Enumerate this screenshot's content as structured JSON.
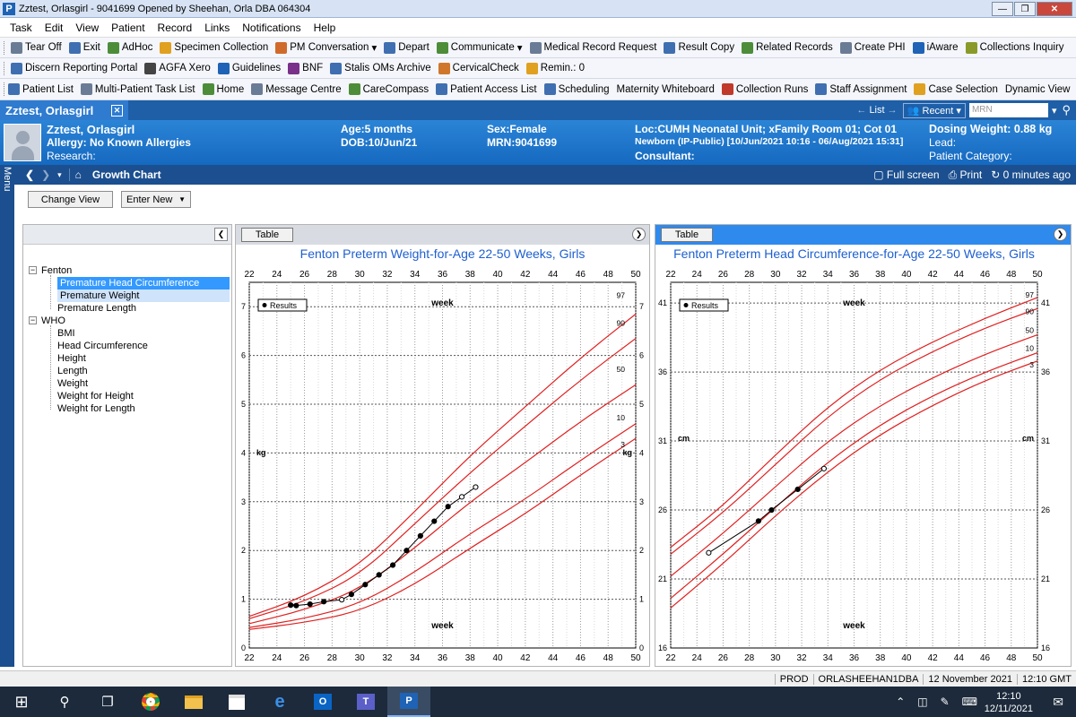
{
  "window": {
    "title": "Zztest, Orlasgirl - 9041699 Opened by Sheehan, Orla   DBA 064304"
  },
  "menu": [
    "Task",
    "Edit",
    "View",
    "Patient",
    "Record",
    "Links",
    "Notifications",
    "Help"
  ],
  "toolbar1": [
    {
      "label": "Tear Off",
      "icon": "tear-off-icon",
      "color": "#6a7b95"
    },
    {
      "label": "Exit",
      "icon": "exit-icon",
      "color": "#3f6fb0"
    },
    {
      "label": "AdHoc",
      "icon": "adhoc-icon",
      "color": "#4d8d3a"
    },
    {
      "label": "Specimen Collection",
      "icon": "specimen-icon",
      "color": "#e0a020"
    },
    {
      "label": "PM Conversation",
      "icon": "pm-conversation-icon",
      "color": "#d06a2a",
      "dropdown": true
    },
    {
      "label": "Depart",
      "icon": "depart-icon",
      "color": "#3f6fb0"
    },
    {
      "label": "Communicate",
      "icon": "communicate-icon",
      "color": "#4d8d3a",
      "dropdown": true
    },
    {
      "label": "Medical Record Request",
      "icon": "medical-record-icon",
      "color": "#6a7b95"
    },
    {
      "label": "Result Copy",
      "icon": "result-copy-icon",
      "color": "#3f6fb0"
    },
    {
      "label": "Related Records",
      "icon": "related-records-icon",
      "color": "#4d8d3a"
    },
    {
      "label": "Create PHI",
      "icon": "create-phi-icon",
      "color": "#6a7b95"
    },
    {
      "label": "iAware",
      "icon": "iaware-icon",
      "color": "#1e63b5"
    },
    {
      "label": "Collections Inquiry",
      "icon": "collections-icon",
      "color": "#8a9a2a"
    }
  ],
  "toolbar2": [
    {
      "label": "Discern Reporting Portal",
      "icon": "discern-icon",
      "color": "#3f6fb0"
    },
    {
      "label": "AGFA Xero",
      "icon": "agfa-icon",
      "color": "#444444"
    },
    {
      "label": "Guidelines",
      "icon": "info-icon",
      "color": "#1e63b5"
    },
    {
      "label": "BNF",
      "icon": "bnf-icon",
      "color": "#7a2f8a"
    },
    {
      "label": "Stalis OMs Archive",
      "icon": "stalis-icon",
      "color": "#3f6fb0"
    },
    {
      "label": "CervicalCheck",
      "icon": "cervicalcheck-icon",
      "color": "#d0762a"
    },
    {
      "label": "Remin.: 0",
      "icon": "reminder-icon",
      "color": "#e0a020"
    }
  ],
  "toolbar3": [
    {
      "label": "Patient List",
      "icon": "patient-list-icon",
      "color": "#3f6fb0"
    },
    {
      "label": "Multi-Patient Task List",
      "icon": "task-list-icon",
      "color": "#6a7b95"
    },
    {
      "label": "Home",
      "icon": "home-icon",
      "color": "#4d8d3a"
    },
    {
      "label": "Message Centre",
      "icon": "message-icon",
      "color": "#6a7b95"
    },
    {
      "label": "CareCompass",
      "icon": "carecompass-icon",
      "color": "#4d8d3a"
    },
    {
      "label": "Patient Access List",
      "icon": "access-list-icon",
      "color": "#3f6fb0"
    },
    {
      "label": "Scheduling",
      "icon": "scheduling-icon",
      "color": "#3f6fb0"
    },
    {
      "label": "Maternity Whiteboard",
      "icon": "",
      "color": ""
    },
    {
      "label": "Collection Runs",
      "icon": "collection-runs-icon",
      "color": "#c0392b"
    },
    {
      "label": "Staff Assignment",
      "icon": "staff-icon",
      "color": "#3f6fb0"
    },
    {
      "label": "Case Selection",
      "icon": "case-icon",
      "color": "#e0a020"
    },
    {
      "label": "Dynamic View",
      "icon": "",
      "color": ""
    }
  ],
  "patient_tab": {
    "name": "Zztest, Orlasgirl",
    "list": "List",
    "recent": "Recent",
    "mrn_placeholder": "MRN"
  },
  "banner": {
    "name": "Zztest, Orlasgirl",
    "allergy": "Allergy: No Known Allergies",
    "research": "Research:",
    "age": "Age:5 months",
    "dob": "DOB:10/Jun/21",
    "sex": "Sex:Female",
    "mrn": "MRN:9041699",
    "loc": "Loc:CUMH Neonatal Unit; xFamily Room 01; Cot 01",
    "encounter": "Newborn (IP-Public) [10/Jun/2021 10:16 - 06/Aug/2021 15:31]",
    "consultant": "Consultant:",
    "dosing": "Dosing Weight: 0.88 kg",
    "lead": "Lead:",
    "category": "Patient Category:"
  },
  "nav": {
    "title": "Growth Chart",
    "fullscreen": "Full screen",
    "print": "Print",
    "updated": "0 minutes ago",
    "menu": "Menu"
  },
  "buttons": {
    "change_view": "Change View",
    "enter_new": "Enter New"
  },
  "tree": {
    "fenton": "Fenton",
    "fenton_items": [
      "Premature Head Circumference",
      "Premature Weight",
      "Premature Length"
    ],
    "who": "WHO",
    "who_items": [
      "BMI",
      "Head Circumference",
      "Height",
      "Length",
      "Weight",
      "Weight for Height",
      "Weight for Length"
    ]
  },
  "charts": [
    {
      "table_btn": "Table",
      "title": "Fenton Preterm Weight-for-Age 22-50 Weeks, Girls",
      "legend": "Results",
      "xlabel": "week",
      "unit": "kg",
      "x_ticks": [
        "22",
        "24",
        "26",
        "28",
        "30",
        "32",
        "34",
        "36",
        "38",
        "40",
        "42",
        "44",
        "46",
        "48",
        "50"
      ],
      "y_ticks": [
        "0",
        "1",
        "2",
        "3",
        "4",
        "5",
        "6",
        "7"
      ],
      "percentile_labels": [
        "97",
        "90",
        "50",
        "10",
        "3"
      ]
    },
    {
      "table_btn": "Table",
      "title": "Fenton Preterm Head Circumference-for-Age 22-50 Weeks, Girls",
      "legend": "Results",
      "xlabel": "week",
      "unit": "cm",
      "x_ticks": [
        "22",
        "24",
        "26",
        "28",
        "30",
        "32",
        "34",
        "36",
        "38",
        "40",
        "42",
        "44",
        "46",
        "48",
        "50"
      ],
      "y_ticks": [
        "16",
        "21",
        "26",
        "31",
        "36",
        "41"
      ],
      "percentile_labels": [
        "97",
        "90",
        "50",
        "10",
        "3"
      ]
    }
  ],
  "chart_data": [
    {
      "type": "line",
      "title": "Fenton Preterm Weight-for-Age 22-50 Weeks, Girls",
      "xlabel": "week",
      "ylabel": "kg",
      "xlim": [
        22,
        50
      ],
      "ylim": [
        0,
        7.5
      ],
      "grid": true,
      "legend": "top-left",
      "percentiles": [
        {
          "name": "97",
          "x": [
            22,
            26,
            30,
            34,
            38,
            42,
            46,
            50
          ],
          "values": [
            0.65,
            1.05,
            1.7,
            2.8,
            3.95,
            4.95,
            5.95,
            6.85
          ]
        },
        {
          "name": "90",
          "x": [
            22,
            26,
            30,
            34,
            38,
            42,
            46,
            50
          ],
          "values": [
            0.6,
            0.95,
            1.5,
            2.55,
            3.6,
            4.55,
            5.5,
            6.35
          ]
        },
        {
          "name": "50",
          "x": [
            22,
            26,
            30,
            34,
            38,
            42,
            46,
            50
          ],
          "values": [
            0.5,
            0.78,
            1.2,
            2.05,
            3.0,
            3.8,
            4.65,
            5.4
          ]
        },
        {
          "name": "10",
          "x": [
            22,
            26,
            30,
            34,
            38,
            42,
            46,
            50
          ],
          "values": [
            0.42,
            0.6,
            0.9,
            1.55,
            2.35,
            3.05,
            3.85,
            4.6
          ]
        },
        {
          "name": "3",
          "x": [
            22,
            26,
            30,
            34,
            38,
            42,
            46,
            50
          ],
          "values": [
            0.38,
            0.52,
            0.75,
            1.3,
            2.05,
            2.75,
            3.55,
            4.3
          ]
        }
      ],
      "series": [
        {
          "name": "Results",
          "x": [
            25.0,
            25.4,
            26.4,
            27.4,
            28.7,
            29.4,
            30.4,
            31.4,
            32.4,
            33.4,
            34.4,
            35.4,
            36.4,
            37.4,
            38.4
          ],
          "values": [
            0.88,
            0.87,
            0.9,
            0.95,
            0.99,
            1.1,
            1.3,
            1.5,
            1.7,
            2.0,
            2.3,
            2.6,
            2.9,
            3.1,
            3.3
          ]
        }
      ]
    },
    {
      "type": "line",
      "title": "Fenton Preterm Head Circumference-for-Age 22-50 Weeks, Girls",
      "xlabel": "week",
      "ylabel": "cm",
      "xlim": [
        22,
        50
      ],
      "ylim": [
        16,
        42.5
      ],
      "grid": true,
      "legend": "top-left",
      "percentiles": [
        {
          "name": "97",
          "x": [
            22,
            26,
            30,
            34,
            38,
            42,
            46,
            50
          ],
          "values": [
            23.3,
            26.3,
            30.0,
            33.5,
            36.2,
            38.2,
            39.9,
            41.4
          ]
        },
        {
          "name": "90",
          "x": [
            22,
            26,
            30,
            34,
            38,
            42,
            46,
            50
          ],
          "values": [
            22.8,
            25.8,
            29.3,
            32.8,
            35.5,
            37.5,
            39.2,
            40.6
          ]
        },
        {
          "name": "50",
          "x": [
            22,
            26,
            30,
            34,
            38,
            42,
            46,
            50
          ],
          "values": [
            21.2,
            24.3,
            27.7,
            31.0,
            33.6,
            35.6,
            37.3,
            38.7
          ]
        },
        {
          "name": "10",
          "x": [
            22,
            26,
            30,
            34,
            38,
            42,
            46,
            50
          ],
          "values": [
            19.6,
            22.8,
            26.2,
            29.5,
            32.2,
            34.3,
            36.0,
            37.4
          ]
        },
        {
          "name": "3",
          "x": [
            22,
            26,
            30,
            34,
            38,
            42,
            46,
            50
          ],
          "values": [
            18.9,
            22.1,
            25.6,
            28.8,
            31.5,
            33.6,
            35.4,
            36.8
          ]
        }
      ],
      "series": [
        {
          "name": "Results",
          "x": [
            24.9,
            28.7,
            29.7,
            31.7,
            33.7
          ],
          "values": [
            22.9,
            25.2,
            26.0,
            27.5,
            29.0
          ]
        }
      ]
    }
  ],
  "status": {
    "env": "PROD",
    "user": "ORLASHEEHAN1DBA",
    "date": "12 November 2021",
    "time": "12:10 GMT"
  },
  "clock": {
    "time": "12:10",
    "date": "12/11/2021"
  }
}
